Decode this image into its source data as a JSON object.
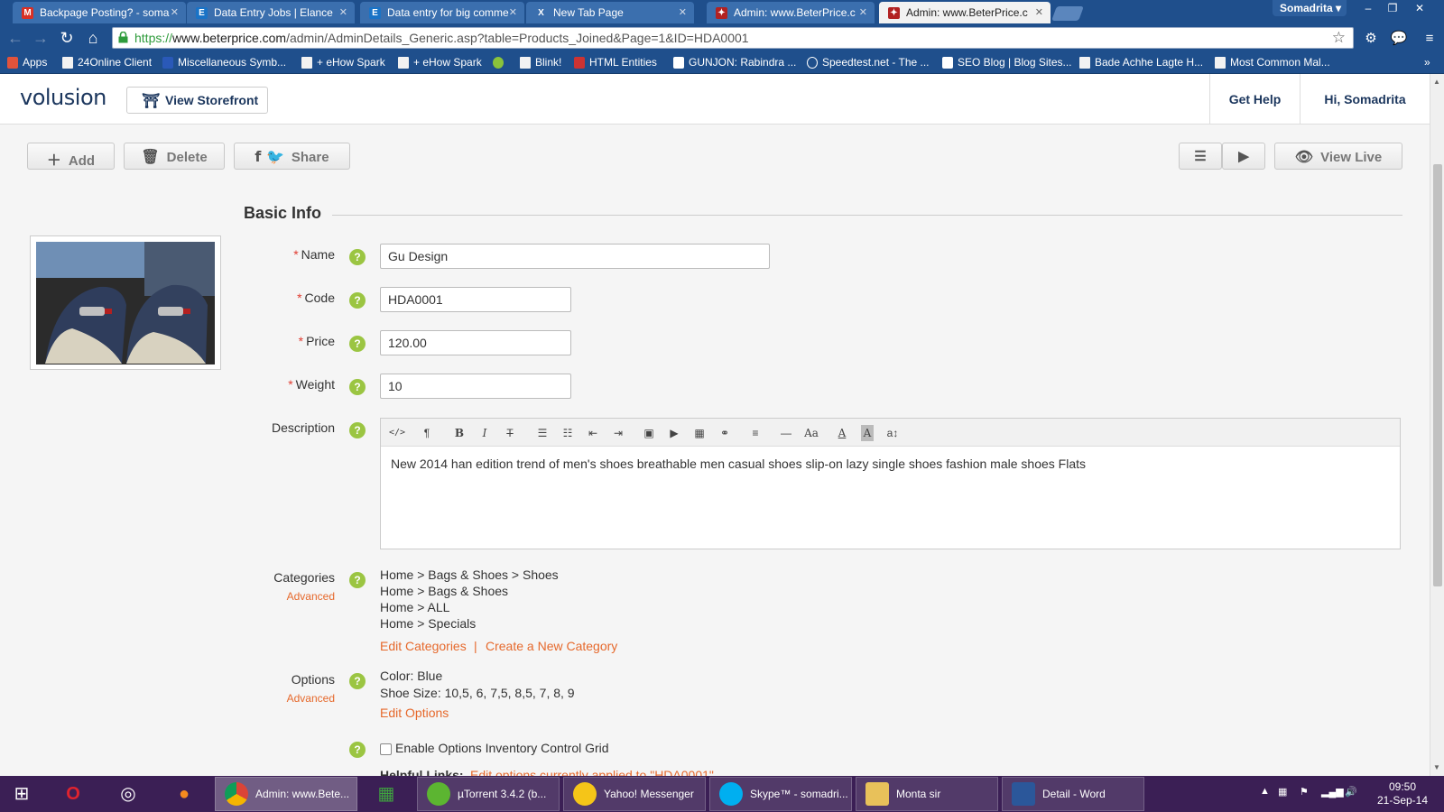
{
  "browser": {
    "tabs": [
      {
        "title": "Backpage Posting? - soma",
        "icon": "gmail-icon",
        "active": false
      },
      {
        "title": "Data Entry Jobs | Elance",
        "icon": "elance-icon",
        "active": false
      },
      {
        "title": "Data entry for big comme",
        "icon": "elance-icon",
        "active": false
      },
      {
        "title": "New Tab Page",
        "icon": "newtab-icon",
        "active": false
      },
      {
        "title": "Admin: www.BeterPrice.c",
        "icon": "volusion-icon",
        "active": false
      },
      {
        "title": "Admin: www.BeterPrice.c",
        "icon": "volusion-icon",
        "active": true
      }
    ],
    "profile": "Somadrita",
    "url_scheme": "https://",
    "url_host": "www.beterprice.com",
    "url_path": "/admin/AdminDetails_Generic.asp?table=Products_Joined&Page=1&ID=HDA0001",
    "bookmarks": [
      "Apps",
      "24Online Client",
      "Miscellaneous Symb...",
      "+ eHow Spark",
      "+ eHow Spark",
      "",
      "Blink!",
      "HTML Entities",
      "GUNJON: Rabindra ...",
      "Speedtest.net - The ...",
      "SEO Blog | Blog Sites...",
      "Bade Achhe Lagte H...",
      "Most Common Mal..."
    ]
  },
  "header": {
    "logo": "volusion",
    "view_storefront": "View Storefront",
    "get_help": "Get Help",
    "greeting": "Hi, Somadrita"
  },
  "actions": {
    "add": "Add",
    "delete": "Delete",
    "share": "Share",
    "view_live": "View Live"
  },
  "form": {
    "section_title": "Basic Info",
    "name_label": "Name",
    "name_value": "Gu Design",
    "code_label": "Code",
    "code_value": "HDA0001",
    "price_label": "Price",
    "price_value": "120.00",
    "weight_label": "Weight",
    "weight_value": "10",
    "description_label": "Description",
    "description_value": "New 2014 han edition trend of men's shoes breathable men casual shoes slip-on lazy single shoes fashion male shoes Flats",
    "categories_label": "Categories",
    "categories_advanced": "Advanced",
    "categories": [
      "Home > Bags & Shoes > Shoes",
      "Home > Bags & Shoes",
      "Home > ALL",
      "Home > Specials"
    ],
    "edit_categories": "Edit Categories",
    "create_category": "Create a New Category",
    "options_label": "Options",
    "options_advanced": "Advanced",
    "options": [
      "Color: Blue",
      "Shoe Size: 10,5, 6, 7,5, 8,5, 7, 8, 9"
    ],
    "edit_options": "Edit Options",
    "enable_grid": "Enable Options Inventory Control Grid",
    "helpful_links_label": "Helpful Links:",
    "helpful_link": "Edit options currently applied to \"HDA0001\""
  },
  "taskbar": {
    "tasks": [
      "Admin: www.Bete...",
      "µTorrent 3.4.2  (b...",
      "Yahoo! Messenger",
      "Skype™ - somadri...",
      "Monta sir",
      "Detail - Word"
    ],
    "time": "09:50",
    "date": "21-Sep-14"
  },
  "colors": {
    "chrome_blue": "#1f4f8c",
    "brand_navy": "#1b365d",
    "link_orange": "#e6692c",
    "help_green": "#9bc542",
    "required_red": "#e03c31",
    "taskbar_purple": "#3b1f55"
  }
}
